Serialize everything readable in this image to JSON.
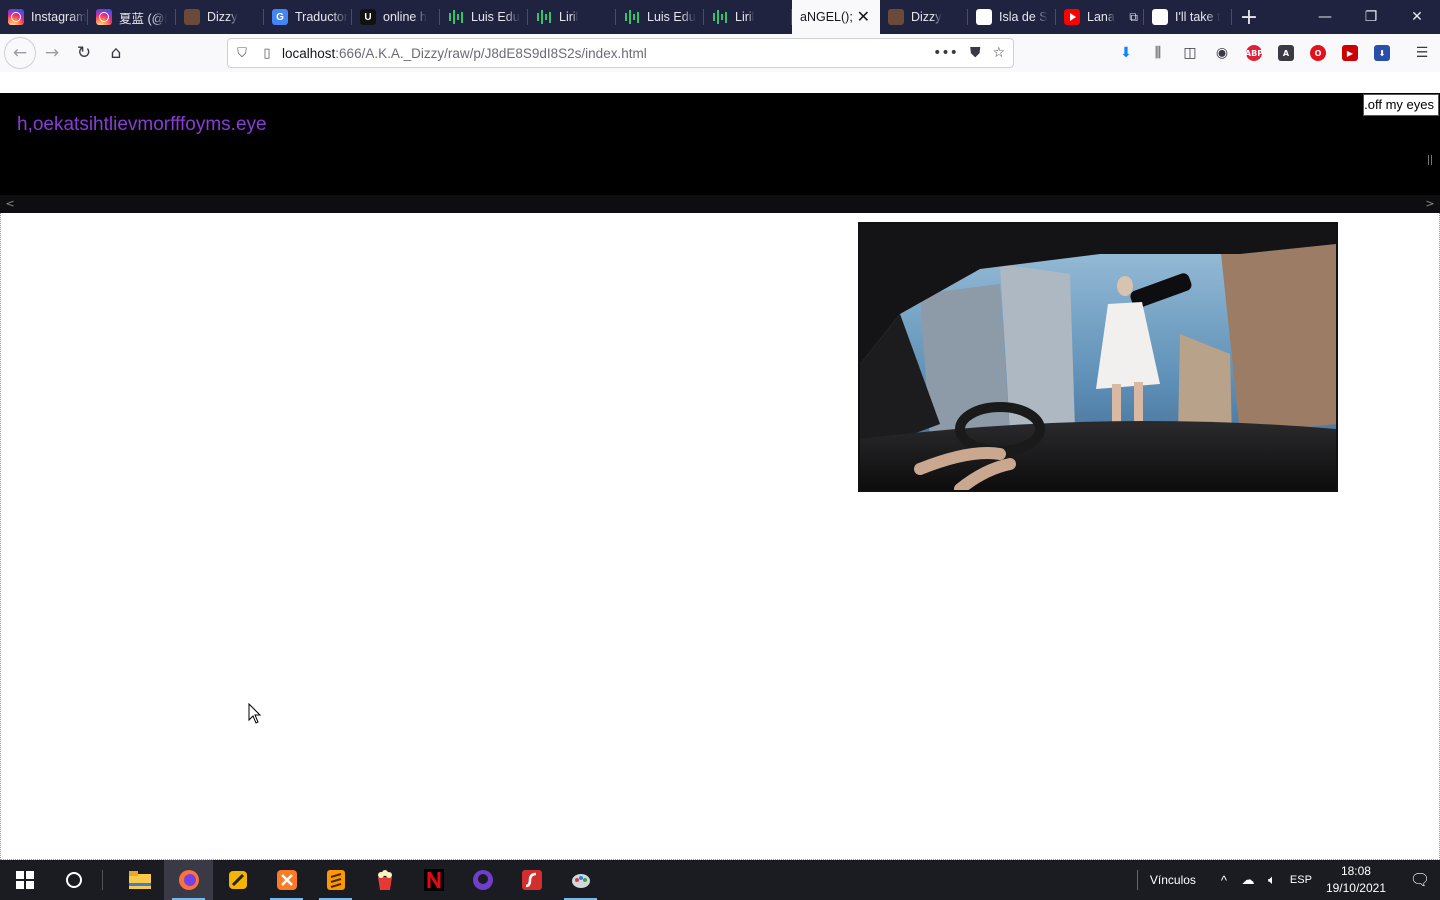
{
  "browser": {
    "tabs": [
      {
        "label": "Instagram",
        "favicon": "instagram-icon",
        "active": false
      },
      {
        "label": "夏蓝 (@l",
        "favicon": "instagram-icon",
        "active": false
      },
      {
        "label": "Dizzy",
        "favicon": "dizzy-icon",
        "active": false
      },
      {
        "label": "Traductor",
        "favicon": "google-translate-icon",
        "active": false
      },
      {
        "label": "online h",
        "favicon": "ul-icon",
        "active": false
      },
      {
        "label": "Luis Edu",
        "favicon": "bars-icon",
        "active": false
      },
      {
        "label": "Liril",
        "favicon": "bars-icon",
        "active": false
      },
      {
        "label": "Luis Edu",
        "favicon": "bars-icon",
        "active": false
      },
      {
        "label": "Liril",
        "favicon": "bars-icon",
        "active": false
      },
      {
        "label": "aNGEL();",
        "favicon": "",
        "active": true
      },
      {
        "label": "Dizzy",
        "favicon": "dizzy-icon",
        "active": false
      },
      {
        "label": "Isla de S",
        "favicon": "wikipedia-icon",
        "active": false
      },
      {
        "label": "Lana",
        "favicon": "youtube-icon",
        "active": false
      },
      {
        "label": "I'll take t",
        "favicon": "google-icon",
        "active": false
      }
    ],
    "new_tab": "+",
    "url_host": "localhost",
    "url_rest": ":666/A.K.A._Dizzy/raw/p/J8dE8S9dI8S2s/index.html"
  },
  "page": {
    "heading": "h,oekatsihtlievmorfffoyms.eye",
    "tooltip": "off my eyes.",
    "photo_alt": "View through car windshield of a giant woman in a white dress standing among city buildings"
  },
  "taskbar": {
    "apps": [
      "windows-start-icon",
      "cortana-icon",
      "file-explorer-icon",
      "firefox-icon",
      "tool-icon",
      "xampp-icon",
      "sublime-icon",
      "popcorn-icon",
      "netflix-icon",
      "github-icon",
      "flash-icon",
      "paint-icon"
    ],
    "tray_label": "Vínculos",
    "language": "ESP",
    "time": "18:08",
    "date": "19/10/2021"
  }
}
